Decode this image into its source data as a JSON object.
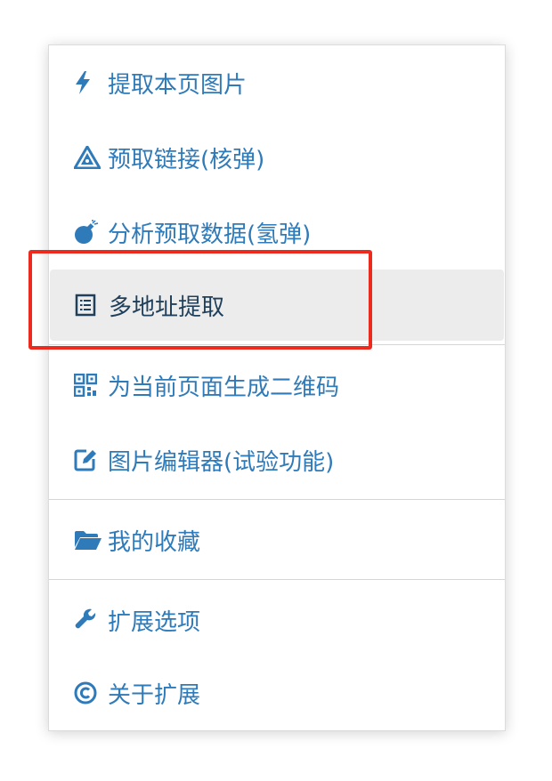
{
  "menu": {
    "items": [
      {
        "label": "提取本页图片",
        "icon": "bolt-icon"
      },
      {
        "label": "预取链接(核弹)",
        "icon": "warning-triangle-icon"
      },
      {
        "label": "分析预取数据(氢弹)",
        "icon": "bomb-icon"
      },
      {
        "label": "多地址提取",
        "icon": "list-document-icon"
      },
      {
        "label": "为当前页面生成二维码",
        "icon": "qrcode-icon"
      },
      {
        "label": "图片编辑器(试验功能)",
        "icon": "edit-icon"
      },
      {
        "label": "我的收藏",
        "icon": "folder-open-icon"
      },
      {
        "label": "扩展选项",
        "icon": "wrench-icon"
      },
      {
        "label": "关于扩展",
        "icon": "copyright-icon"
      }
    ],
    "active_item": "多地址提取"
  },
  "colors": {
    "link": "#2f7ab8",
    "active_text": "#1f3f5a",
    "active_bg": "#ececec",
    "highlight": "#ec2b1e"
  }
}
